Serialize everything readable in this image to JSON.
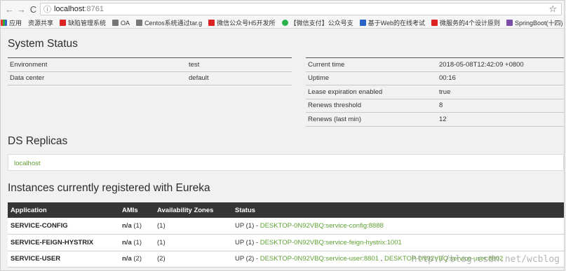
{
  "browser": {
    "url_host": "localhost",
    "url_port": ":8761",
    "bookmarks": [
      {
        "icon": "apps-icon",
        "label": "应用"
      },
      {
        "icon": "page-icon",
        "label": "资源共享"
      },
      {
        "icon": "red-logo-icon",
        "label": "缺陷管理系统"
      },
      {
        "icon": "oa-icon",
        "label": "OA"
      },
      {
        "icon": "gear-icon",
        "label": "Centos系统通过tar.g"
      },
      {
        "icon": "c-logo-icon",
        "label": "微信公众号H5开发所"
      },
      {
        "icon": "wechat-icon",
        "label": "【微信支付】公众号支"
      },
      {
        "icon": "blue-bookmark-icon",
        "label": "基于Web的在线考试"
      },
      {
        "icon": "c-logo-icon",
        "label": "微服务的4个设计原则"
      },
      {
        "icon": "purple-book-icon",
        "label": "SpringBoot(十四)：s"
      }
    ]
  },
  "status": {
    "title": "System Status",
    "left": [
      {
        "label": "Environment",
        "value": "test"
      },
      {
        "label": "Data center",
        "value": "default"
      }
    ],
    "right": [
      {
        "label": "Current time",
        "value": "2018-05-08T12:42:09 +0800"
      },
      {
        "label": "Uptime",
        "value": "00:16"
      },
      {
        "label": "Lease expiration enabled",
        "value": "true"
      },
      {
        "label": "Renews threshold",
        "value": "8"
      },
      {
        "label": "Renews (last min)",
        "value": "12"
      }
    ]
  },
  "replicas": {
    "title": "DS Replicas",
    "item": "localhost"
  },
  "instances": {
    "title": "Instances currently registered with Eureka",
    "headers": [
      "Application",
      "AMIs",
      "Availability Zones",
      "Status"
    ],
    "rows": [
      {
        "app": "SERVICE-CONFIG",
        "ami_na": "n/a",
        "ami_count": "(1)",
        "zones": "(1)",
        "status_prefix": "UP (1) - ",
        "links": [
          "DESKTOP-0N92VBQ:service-config:8888"
        ]
      },
      {
        "app": "SERVICE-FEIGN-HYSTRIX",
        "ami_na": "n/a",
        "ami_count": "(1)",
        "zones": "(1)",
        "status_prefix": "UP (1) - ",
        "links": [
          "DESKTOP-0N92VBQ:service-feign-hystrix:1001"
        ]
      },
      {
        "app": "SERVICE-USER",
        "ami_na": "n/a",
        "ami_count": "(2)",
        "zones": "(2)",
        "status_prefix": "UP (2) - ",
        "links": [
          "DESKTOP-0N92VBQ:service-user:8801",
          "DESKTOP-0N92VBQ:service-user:8802"
        ]
      }
    ]
  },
  "watermark": "http://blog.csdn.net/wcblog",
  "colors": {
    "link_green": "#5fa134",
    "header_dark": "#353535"
  }
}
